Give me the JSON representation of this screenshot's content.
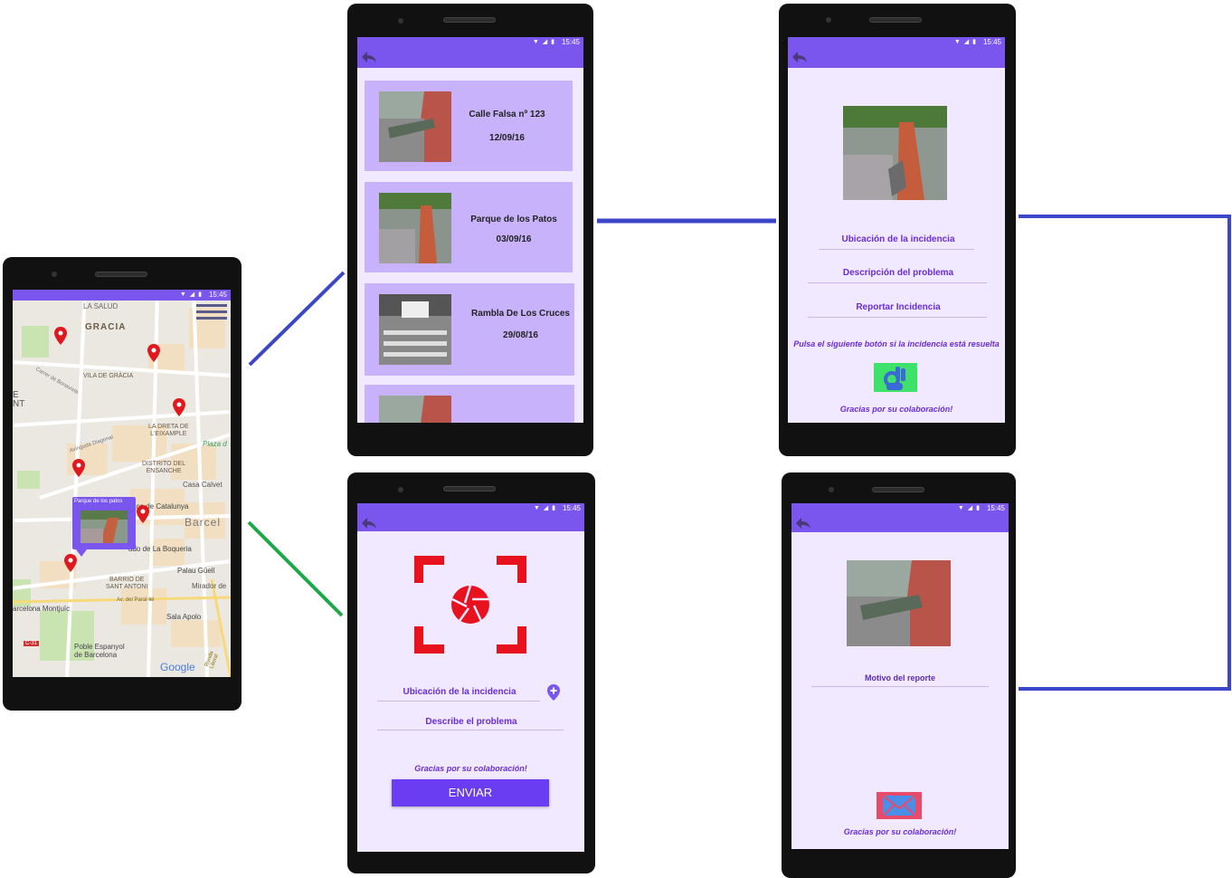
{
  "status_time": "15:45",
  "map_screen": {
    "labels": {
      "la_salud": "LA SALUD",
      "gracia": "GRACIA",
      "vila_de_gracia": "VILA DE GRÀCIA",
      "carrer_de_bonavista": "Carrer de Bonavista",
      "la_dreta": "LA DRETA DE\nL'EIXAMPLE",
      "avinguda_diagonal": "Avinguda Diagonal",
      "plaza": "Plaza d",
      "distrito": "DISTRITO DEL\nENSANCHE",
      "casa_calvet": "Casa Calvet",
      "placa_catalunya": "Plaça de Catalunya",
      "barcelona": "Barcel",
      "mercado": "ado de La Boqueria",
      "palau_guell": "Palau Güell",
      "barrio_sant_antoni": "BARRIO DE\nSANT ANTONI",
      "mirador": "Mirador de",
      "av_paral_lel": "Av. del Paral·lel",
      "montjuic": "arcelona Montjuïc",
      "sala_apolo": "Sala Apolo",
      "c31": "C-31",
      "poble_espanyol": "Poble Espanyol\nde Barcelona",
      "google": "Google",
      "ronda_litoral": "Ronda Litoral",
      "e_label": "E\nNT"
    },
    "popup_title": "Parque de los patos"
  },
  "list_screen": {
    "items": [
      {
        "address": "Calle Falsa nº 123",
        "date": "12/09/16"
      },
      {
        "address": "Parque de los Patos",
        "date": "03/09/16"
      },
      {
        "address": "Rambla De Los Cruces",
        "date": "29/08/16"
      }
    ]
  },
  "detail_screen": {
    "location_link": "Ubicación de la incidencia",
    "description_link": "Descripción del problema",
    "report_link": "Reportar Incidencia",
    "resolved_prompt": "Pulsa el siguiente botón si la incidencia está resuelta",
    "thanks": "Gracias por su colaboración!"
  },
  "new_screen": {
    "location_field": "Ubicación de la incidencia",
    "describe_field": "Describe el problema",
    "thanks": "Gracias por su colaboración!",
    "send_button": "ENVIAR"
  },
  "report_screen": {
    "reason_field": "Motivo del reporte",
    "thanks": "Gracias por su colaboración!"
  },
  "colors": {
    "accent": "#7a55ee",
    "connector_blue": "#3b46c8",
    "connector_green": "#1ea84a",
    "marker_red": "#e0191f",
    "camera_red": "#e8111e"
  },
  "icons": {
    "back": "back-arrow-icon",
    "menu": "hamburger-menu-icon",
    "marker": "map-marker-icon",
    "camera": "camera-shutter-icon",
    "add_location": "add-location-icon",
    "resolved": "ok-hand-icon",
    "send": "envelope-icon"
  }
}
